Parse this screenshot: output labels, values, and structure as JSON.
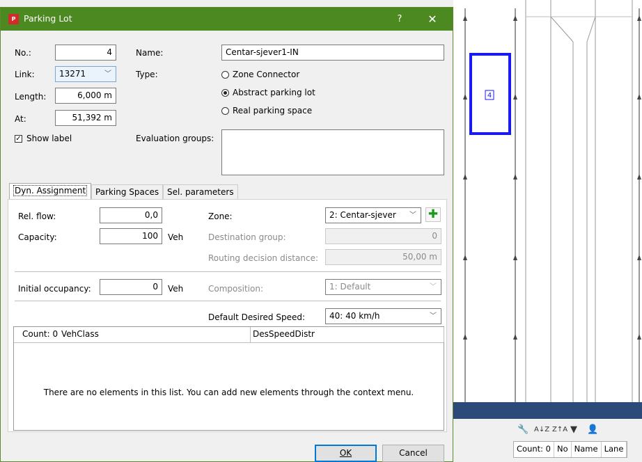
{
  "dialog": {
    "title": "Parking Lot",
    "help_glyph": "?",
    "close_glyph": "✕",
    "icon_text": "P"
  },
  "fields": {
    "no_label": "No.:",
    "no_value": "4",
    "link_label": "Link:",
    "link_value": "13271",
    "length_label": "Length:",
    "length_value": "6,000 m",
    "at_label": "At:",
    "at_value": "51,392 m",
    "name_label": "Name:",
    "name_value": "Centar-sjever1-IN",
    "type_label": "Type:",
    "type_options": [
      "Zone Connector",
      "Abstract parking lot",
      "Real parking space"
    ],
    "type_selected_index": 1,
    "show_label": "Show label",
    "show_label_checked": true,
    "evaluation_groups_label": "Evaluation groups:"
  },
  "tabs": [
    "Dyn. Assignment",
    "Parking Spaces",
    "Sel. parameters"
  ],
  "active_tab": 0,
  "dyn": {
    "rel_flow_label": "Rel. flow:",
    "rel_flow_value": "0,0",
    "capacity_label": "Capacity:",
    "capacity_value": "100",
    "capacity_unit": "Veh",
    "zone_label": "Zone:",
    "zone_value": "2: Centar-sjever",
    "destination_group_label": "Destination group:",
    "destination_group_value": "0",
    "routing_label": "Routing decision distance:",
    "routing_value": "50,00 m",
    "initial_occupancy_label": "Initial occupancy:",
    "initial_occupancy_value": "0",
    "initial_occupancy_unit": "Veh",
    "composition_label": "Composition:",
    "composition_value": "1: Default",
    "desired_speed_label": "Default Desired Speed:",
    "desired_speed_value": "40: 40 km/h"
  },
  "list": {
    "columns": [
      "Count: 0",
      "VehClass",
      "DesSpeedDistr"
    ],
    "empty_message": "There are no elements in this list. You can add new elements through the context menu."
  },
  "buttons": {
    "ok": "OK",
    "cancel": "Cancel"
  },
  "network": {
    "parking_label": "4"
  },
  "bottom_panel": {
    "columns": [
      "Count: 0",
      "No",
      "Name",
      "Lane"
    ]
  }
}
